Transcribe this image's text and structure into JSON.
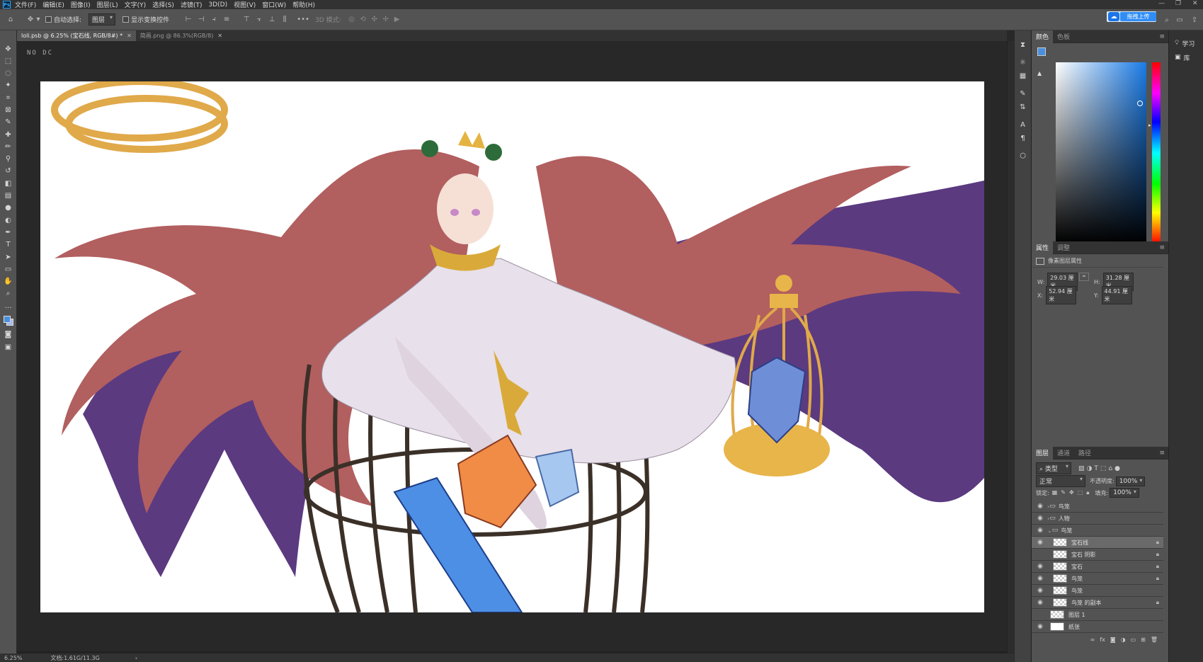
{
  "menubar": {
    "logo": "Ps",
    "items": [
      "文件(F)",
      "编辑(E)",
      "图像(I)",
      "图层(L)",
      "文字(Y)",
      "选择(S)",
      "滤镜(T)",
      "3D(D)",
      "视图(V)",
      "窗口(W)",
      "帮助(H)"
    ]
  },
  "options": {
    "auto_select_label": "自动选择:",
    "auto_select_value": "图层",
    "show_transform_label": "显示变换控件",
    "mode_label": "3D 模式:",
    "upload_label": "拖拽上传"
  },
  "tabs": [
    {
      "label": "loli.psb @ 6.25% (宝石线, RGB/8#) *",
      "active": true
    },
    {
      "label": "简画.png @ 86.3%(RGB/8)",
      "active": false
    }
  ],
  "canvas": {
    "label": "NO DC"
  },
  "status": {
    "zoom": "6.25%",
    "doc_info": "文档:1.61G/11.3G",
    "arrow": "›"
  },
  "color_panel": {
    "tabs": [
      "颜色",
      "色板"
    ],
    "fg": "#4a8fdc",
    "bg": "#a7b7e8"
  },
  "props_panel": {
    "tabs": [
      "属性",
      "调整"
    ],
    "type_label": "像素图层属性",
    "w_label": "W:",
    "w_value": "29.03 厘米",
    "h_label": "H:",
    "h_value": "31.28 厘米",
    "x_label": "X:",
    "x_value": "52.94 厘米",
    "y_label": "Y:",
    "y_value": "44.91 厘米"
  },
  "layers_panel": {
    "tabs": [
      "图层",
      "通道",
      "路径"
    ],
    "filter": "类型",
    "blend": "正常",
    "opacity_label": "不透明度:",
    "opacity": "100%",
    "lock_label": "锁定:",
    "fill_label": "填充:",
    "fill": "100%",
    "layers": [
      {
        "name": "鸟笼",
        "kind": "group",
        "visible": true,
        "indent": 0
      },
      {
        "name": "人物",
        "kind": "group",
        "visible": true,
        "indent": 0
      },
      {
        "name": "鸟笼",
        "kind": "group",
        "visible": true,
        "indent": 0,
        "open": true
      },
      {
        "name": "宝石线",
        "kind": "layer",
        "visible": true,
        "indent": 1,
        "selected": true,
        "locked": true
      },
      {
        "name": "宝石 阴影",
        "kind": "layer",
        "visible": false,
        "indent": 1,
        "locked": true
      },
      {
        "name": "宝石",
        "kind": "layer",
        "visible": true,
        "indent": 1,
        "locked": true
      },
      {
        "name": "鸟笼",
        "kind": "layer",
        "visible": true,
        "indent": 1,
        "locked": true
      },
      {
        "name": "鸟笼",
        "kind": "layer",
        "visible": true,
        "indent": 1,
        "locked": false
      },
      {
        "name": "鸟笼 的副本",
        "kind": "layer",
        "visible": true,
        "indent": 1,
        "locked": true
      },
      {
        "name": "图层 1",
        "kind": "layer",
        "visible": false,
        "indent": 0,
        "locked": false
      },
      {
        "name": "纸张",
        "kind": "layer",
        "visible": true,
        "indent": 0,
        "locked": false
      }
    ]
  },
  "far_right": {
    "learn": "学习",
    "library": "库"
  }
}
